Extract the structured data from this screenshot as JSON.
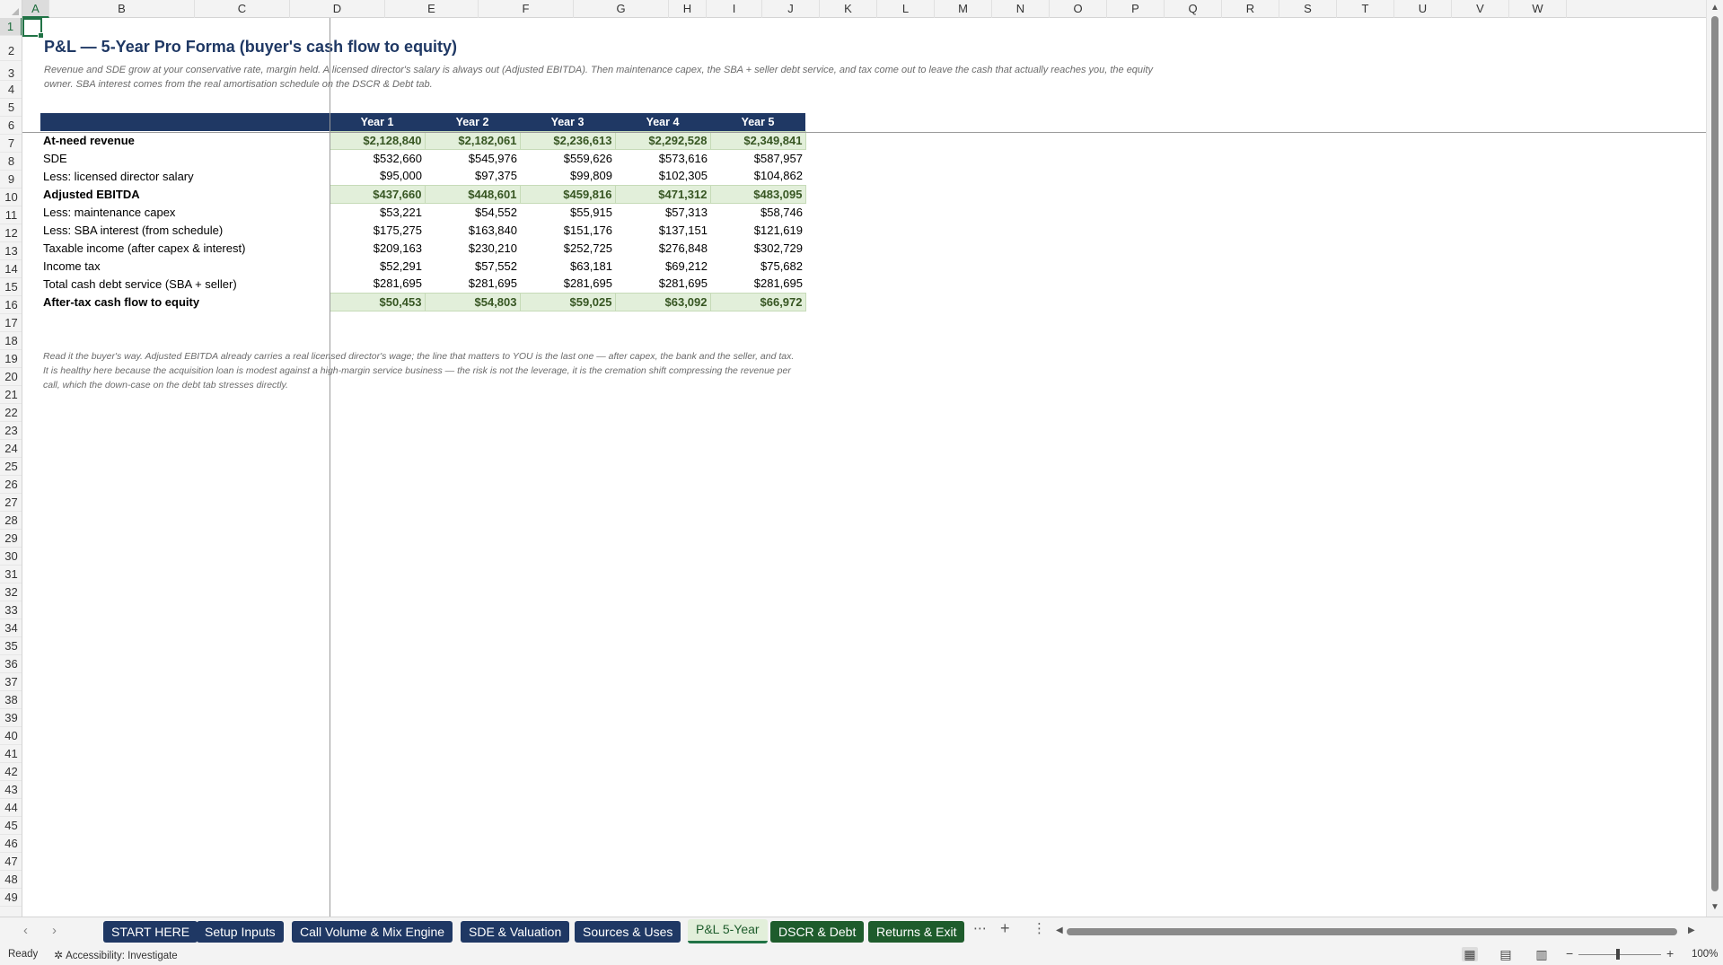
{
  "columns": [
    "A",
    "B",
    "C",
    "D",
    "E",
    "F",
    "G",
    "H",
    "I",
    "J",
    "K",
    "L",
    "M",
    "N",
    "O",
    "P",
    "Q",
    "R",
    "S",
    "T",
    "U",
    "V",
    "W"
  ],
  "rows": [
    "1",
    "2",
    "3",
    "4",
    "5",
    "6",
    "7",
    "8",
    "9",
    "10",
    "11",
    "12",
    "13",
    "14",
    "15",
    "16",
    "17",
    "18",
    "19",
    "20",
    "21",
    "22",
    "23",
    "24",
    "25",
    "26",
    "27",
    "28",
    "29",
    "30",
    "31",
    "32",
    "33",
    "34",
    "35",
    "36",
    "37",
    "38",
    "39",
    "40",
    "41",
    "42",
    "43",
    "44",
    "45",
    "46",
    "47",
    "48",
    "49"
  ],
  "sheet": {
    "title": "P&L — 5-Year Pro Forma (buyer's cash flow to equity)",
    "subtitle": "Revenue and SDE grow at your conservative rate, margin held. A licensed director's salary is always out (Adjusted EBITDA). Then maintenance capex, the SBA + seller debt service, and tax come out to leave the cash that actually reaches you, the equity owner. SBA interest comes from the real amortisation schedule on the DSCR & Debt tab.",
    "note": "Read it the buyer's way. Adjusted EBITDA already carries a real licensed director's wage; the line that matters to YOU is the last one — after capex, the bank and the seller, and tax. It is healthy here because the acquisition loan is modest against a high-margin service business — the risk is not the leverage, it is the cremation shift compressing the revenue per call, which the down-case on the debt tab stresses directly.",
    "headers": [
      "Year 1",
      "Year 2",
      "Year 3",
      "Year 4",
      "Year 5"
    ],
    "lines": [
      {
        "label": "At-need revenue",
        "values": [
          "$2,128,840",
          "$2,182,061",
          "$2,236,613",
          "$2,292,528",
          "$2,349,841"
        ]
      },
      {
        "label": "SDE",
        "values": [
          "$532,660",
          "$545,976",
          "$559,626",
          "$573,616",
          "$587,957"
        ]
      },
      {
        "label": "Less: licensed director salary",
        "values": [
          "$95,000",
          "$97,375",
          "$99,809",
          "$102,305",
          "$104,862"
        ]
      },
      {
        "label": "Adjusted EBITDA",
        "values": [
          "$437,660",
          "$448,601",
          "$459,816",
          "$471,312",
          "$483,095"
        ]
      },
      {
        "label": "Less: maintenance capex",
        "values": [
          "$53,221",
          "$54,552",
          "$55,915",
          "$57,313",
          "$58,746"
        ]
      },
      {
        "label": "Less: SBA interest (from schedule)",
        "values": [
          "$175,275",
          "$163,840",
          "$151,176",
          "$137,151",
          "$121,619"
        ]
      },
      {
        "label": "Taxable income (after capex & interest)",
        "values": [
          "$209,163",
          "$230,210",
          "$252,725",
          "$276,848",
          "$302,729"
        ]
      },
      {
        "label": "Income tax",
        "values": [
          "$52,291",
          "$57,552",
          "$63,181",
          "$69,212",
          "$75,682"
        ]
      },
      {
        "label": "Total cash debt service (SBA + seller)",
        "values": [
          "$281,695",
          "$281,695",
          "$281,695",
          "$281,695",
          "$281,695"
        ]
      },
      {
        "label": "After-tax cash flow to equity",
        "values": [
          "$50,453",
          "$54,803",
          "$59,025",
          "$63,092",
          "$66,972"
        ]
      }
    ]
  },
  "tabs": [
    {
      "label": "START HERE",
      "style": "navy"
    },
    {
      "label": "Setup Inputs",
      "style": "navy"
    },
    {
      "label": "Call Volume & Mix Engine",
      "style": "navy"
    },
    {
      "label": "SDE & Valuation",
      "style": "navy"
    },
    {
      "label": "Sources & Uses",
      "style": "navy"
    },
    {
      "label": "P&L 5-Year",
      "style": "active"
    },
    {
      "label": "DSCR & Debt",
      "style": "green"
    },
    {
      "label": "Returns & Exit",
      "style": "green"
    }
  ],
  "status": {
    "ready": "Ready",
    "accessibility": "Accessibility: Investigate",
    "zoom": "100%"
  },
  "icons": {
    "tab_prev": "chevron-left-icon",
    "tab_next": "chevron-right-icon",
    "more": "more-icon",
    "add_sheet": "plus-icon",
    "options": "vertical-dots-icon"
  },
  "colors": {
    "header_navy": "#1f3864",
    "highlight_fill": "#e2efda",
    "highlight_text": "#375623",
    "selection_green": "#217346"
  }
}
